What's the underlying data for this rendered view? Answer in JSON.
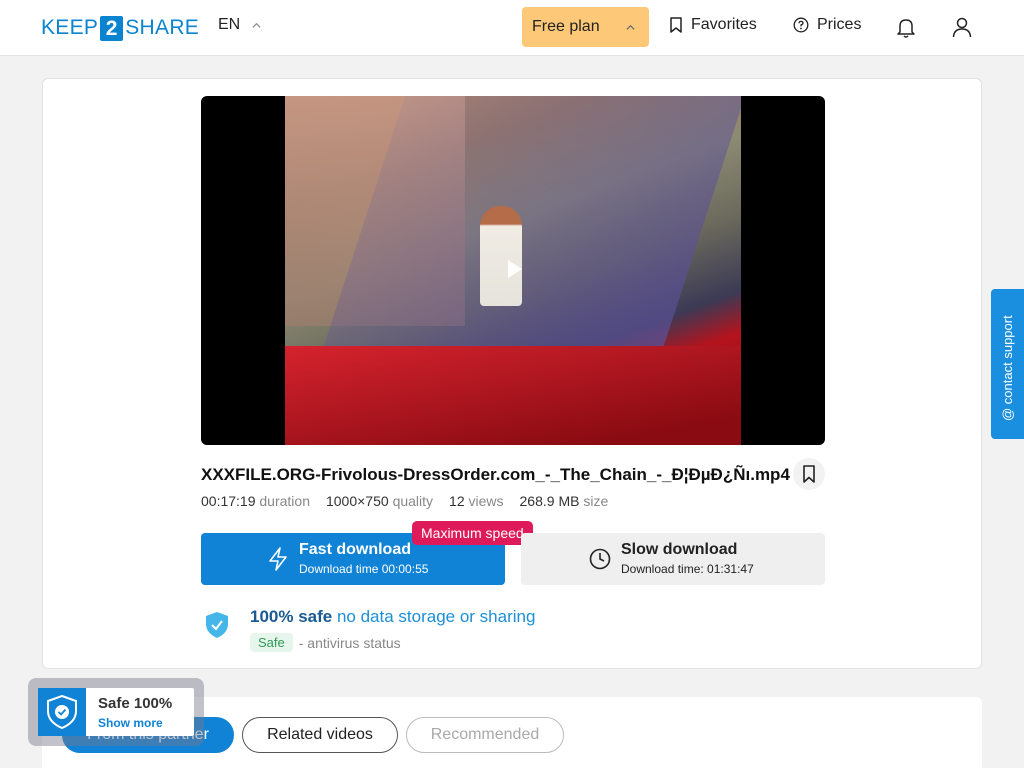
{
  "header": {
    "logo_left": "KEEP",
    "logo_number": "2",
    "logo_right": "SHARE",
    "language": "EN",
    "plan_label": "Free plan",
    "favorites_label": "Favorites",
    "prices_label": "Prices"
  },
  "file": {
    "name": "XXXFILE.ORG-Frivolous-DressOrder.com_-_The_Chain_-_Ð¦ÐµÐ¿Ñı.mp4",
    "duration_value": "00:17:19",
    "duration_label": "duration",
    "quality_value": "1000×750",
    "quality_label": "quality",
    "views_value": "12",
    "views_label": "views",
    "size_value": "268.9 MB",
    "size_label": "size"
  },
  "download": {
    "fast_title": "Fast download",
    "fast_time": "Download time 00:00:55",
    "max_speed_badge": "Maximum speed",
    "slow_title": "Slow download",
    "slow_time": "Download time: 01:31:47"
  },
  "safety": {
    "headline_strong": "100% safe",
    "headline_rest": "no data storage or sharing",
    "antivirus_badge": "Safe",
    "antivirus_label": "- antivirus status"
  },
  "tabs": [
    {
      "label": "From this partner",
      "active": true
    },
    {
      "label": "Related videos",
      "active": false
    },
    {
      "label": "Recommended",
      "active": false
    }
  ],
  "safe_popup": {
    "title": "Safe 100%",
    "link": "Show more"
  },
  "support": {
    "label": "@ contact support"
  },
  "colors": {
    "brand_blue": "#1083d6",
    "plan_orange": "#fdc878",
    "badge_pink": "#de1a5a"
  }
}
